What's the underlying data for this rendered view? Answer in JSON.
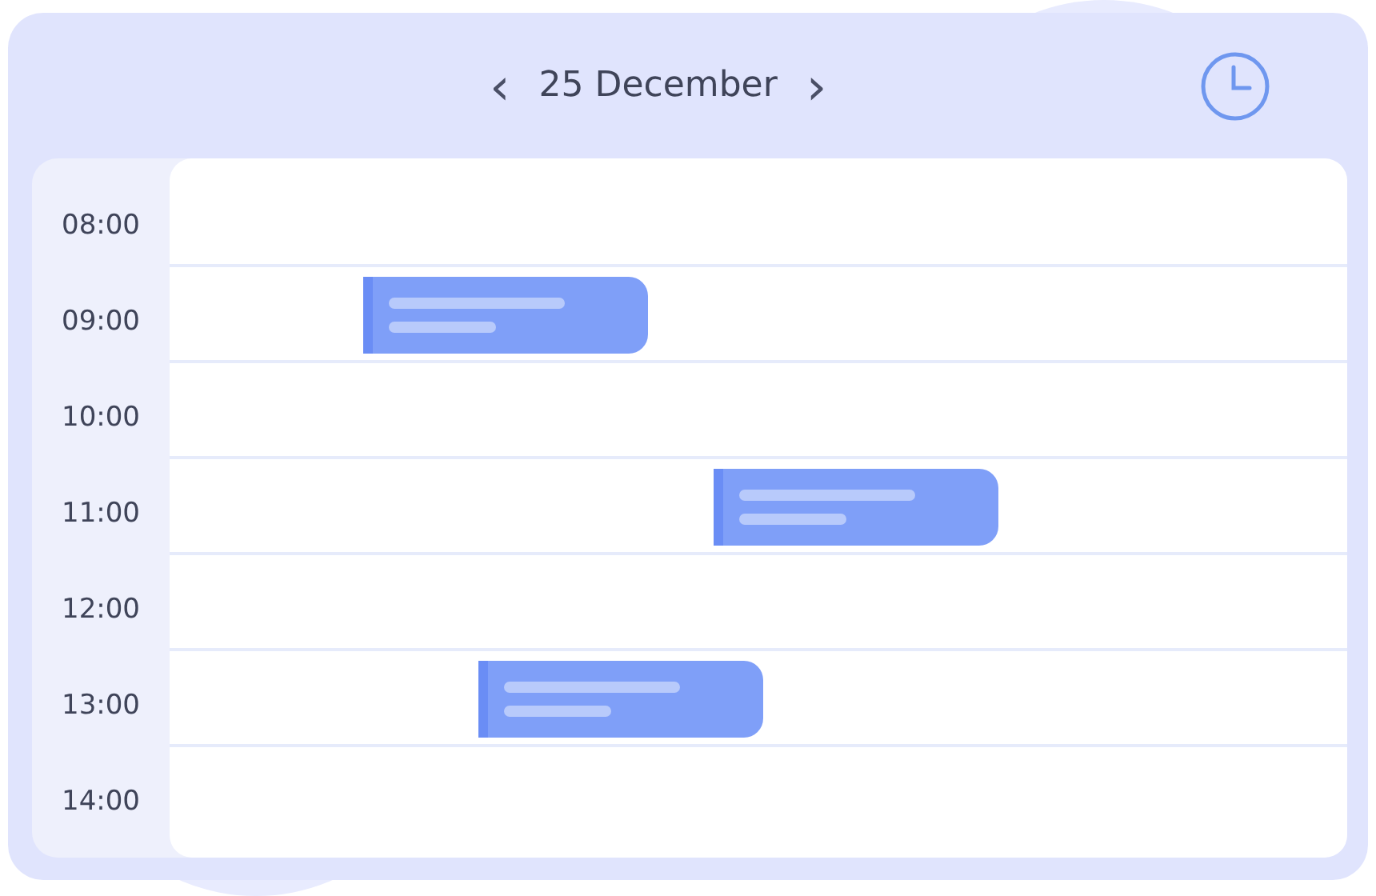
{
  "header": {
    "prev": "‹",
    "date": "25 December",
    "next": "›"
  },
  "rows": [
    {
      "time": "08:00",
      "has_event": false
    },
    {
      "time": "09:00",
      "has_event": true
    },
    {
      "time": "10:00",
      "has_event": false
    },
    {
      "time": "11:00",
      "has_event": true
    },
    {
      "time": "12:00",
      "has_event": false
    },
    {
      "time": "13:00",
      "has_event": true
    },
    {
      "time": "14:00",
      "has_event": false
    }
  ]
}
